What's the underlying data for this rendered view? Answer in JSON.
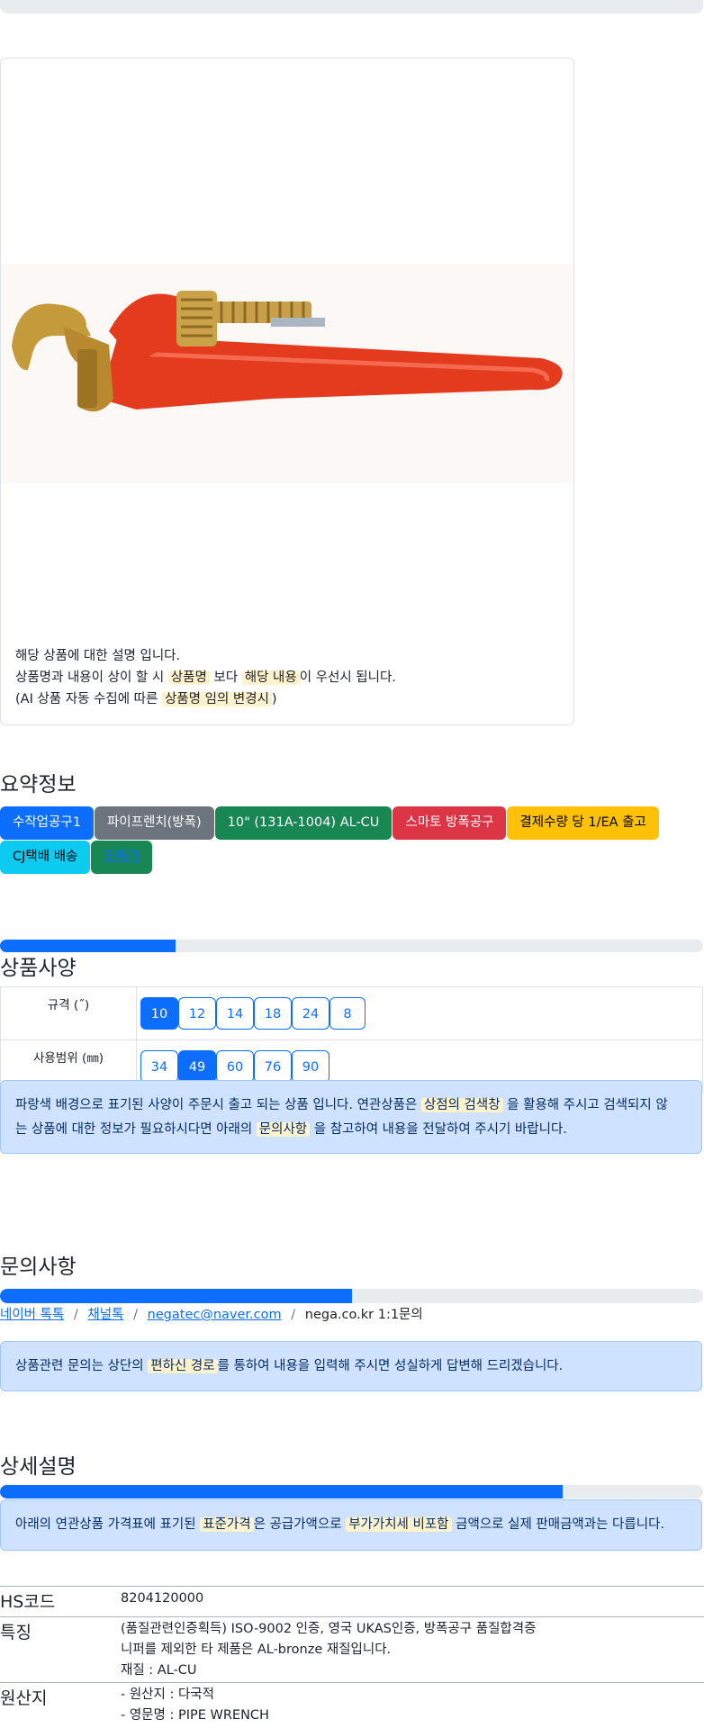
{
  "top_progress": {
    "fill_fraction": 0
  },
  "product_card": {
    "image_alt": "pipe wrench",
    "desc_line1": "해당 상품에 대한 설명 입니다.",
    "desc_line2_a": "상품명과 내용이 상이 할 시 ",
    "desc_line2_hl1": "상품명",
    "desc_line2_b": " 보다 ",
    "desc_line2_hl2": "해당 내용",
    "desc_line2_c": "이 우선시 됩니다.",
    "desc_line3_a": "(AI 상품 자동 수집에 따른 ",
    "desc_line3_hl": "상품명 임의 변경시",
    "desc_line3_b": ")"
  },
  "summary": {
    "title": "요약정보",
    "tags": [
      {
        "label": "수작업공구1",
        "color": "#0d6efd"
      },
      {
        "label": "파이프렌치(방폭)",
        "color": "#6c757d"
      },
      {
        "label": "10\" (131A-1004) AL-CU",
        "color": "#198754"
      },
      {
        "label": "스마토 방폭공구",
        "color": "#dc3545"
      },
      {
        "label": "결제수량 당 1/EA 출고",
        "color": "#ffc107"
      },
      {
        "label": "CJ택배 배송",
        "color": "#0dcaf0"
      },
      {
        "label": "도매가",
        "color": "#198754"
      }
    ]
  },
  "spec": {
    "title": "상품사양",
    "progress_fraction": 0.25,
    "rows": [
      {
        "label": "규격 (˝)",
        "options": [
          "10",
          "12",
          "14",
          "18",
          "24",
          "8"
        ],
        "active": "10"
      },
      {
        "label": "사용범위 (㎜)",
        "options": [
          "34",
          "49",
          "60",
          "76",
          "90"
        ],
        "active": "49"
      }
    ],
    "notice_a": "파랑색 배경으로 표기된 사양이 주문시 출고 되는 상품 입니다. 연관상품은 ",
    "notice_hl1": "상점의 검색창",
    "notice_b": " 을 활용해 주시고 검색되지 않",
    "notice_c": "는 상품에 대한 정보가 필요하시다면 아래의 ",
    "notice_hl2": "문의사항",
    "notice_d": " 을 참고하여 내용을 전달하여 주시기 바랍니다."
  },
  "inquiry": {
    "title": "문의사항",
    "progress_fraction": 0.5,
    "breadcrumb": [
      "네이버 톡톡",
      "채널톡",
      "negatec@naver.com",
      "nega.co.kr 1:1문의"
    ],
    "sep": "/",
    "notice_a": "상품관련 문의는 상단의 ",
    "notice_hl": "편하신 경로",
    "notice_b": "를 통하여 내용을 입력해 주시면 성실하게 답변해 드리겠습니다."
  },
  "detail": {
    "title": "상세설명",
    "progress_fraction": 0.8,
    "notice_a": "아래의 연관상품 가격표에 표기된 ",
    "notice_hl1": "표준가격",
    "notice_b": "은 공급가액으로 ",
    "notice_hl2": "부가가치세 비포함",
    "notice_c": " 금액으로 실제 판매금액과는 다릅니다.",
    "rows": [
      {
        "key": "HS코드",
        "lines": [
          "8204120000"
        ]
      },
      {
        "key": "특징",
        "lines": [
          "(품질관련인증획득) ISO-9002 인증, 영국 UKAS인증, 방폭공구 품질합격증",
          "니퍼를 제외한 타 제품은 AL-bronze 재질입니다.",
          "재질 : AL-CU"
        ]
      },
      {
        "key": "원산지",
        "lines": [
          "- 원산지 : 다국적",
          "- 영문명 : PIPE WRENCH"
        ]
      }
    ]
  }
}
